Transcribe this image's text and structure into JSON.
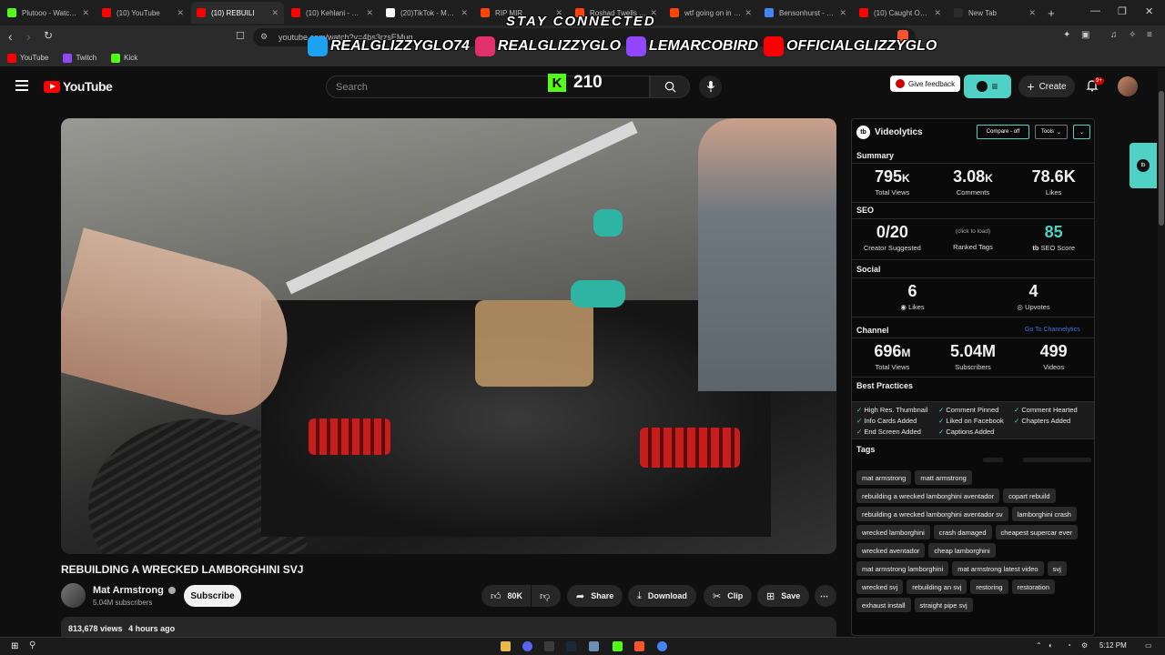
{
  "browser": {
    "tabs": [
      {
        "label": "Plutooo - Watch the",
        "color": "#53fc18",
        "active": false
      },
      {
        "label": "(10) YouTube",
        "color": "#ff0000",
        "active": false
      },
      {
        "label": "(10) REBUILI",
        "color": "#ff0000",
        "active": true
      },
      {
        "label": "(10) Kehlani - Foldi",
        "color": "#ff0000",
        "active": false
      },
      {
        "label": "(20)TikTok - Make",
        "color": "#ffffff",
        "active": false
      },
      {
        "label": "RIP MIR",
        "color": "#ff4500",
        "active": false
      },
      {
        "label": "Roshad Twells aka",
        "color": "#ff4500",
        "active": false
      },
      {
        "label": "wtf going on in Be",
        "color": "#ff4500",
        "active": false
      },
      {
        "label": "Bensonhurst - Goo",
        "color": "#4285f4",
        "active": false
      },
      {
        "label": "(10) Caught On Vi",
        "color": "#ff0000",
        "active": false
      },
      {
        "label": "New Tab",
        "color": "#2b2b2b",
        "active": false
      }
    ],
    "url": "youtube.com/watch?v=4bs3rzsEMug",
    "bookmarks": [
      {
        "label": "YouTube",
        "color": "#ff0000"
      },
      {
        "label": "Twitch",
        "color": "#9146ff"
      },
      {
        "label": "Kick",
        "color": "#53fc18"
      }
    ]
  },
  "overlay": {
    "title": "STAY CONNECTED",
    "socials": [
      {
        "handle": "REALGLIZZYGLO74",
        "icon": "twitter-icon",
        "color": "#1da1f2"
      },
      {
        "handle": "REALGLIZZYGLO",
        "icon": "instagram-icon",
        "color": "#e1306c"
      },
      {
        "handle": "LEMARCOBIRD",
        "icon": "twitch-icon",
        "color": "#9146ff"
      },
      {
        "handle": "OFFICIALGLIZZYGLO",
        "icon": "youtube-icon",
        "color": "#ff0000"
      }
    ],
    "kick_viewers": "210"
  },
  "youtube": {
    "logo": "YouTube",
    "search_placeholder": "Search",
    "feedback": "Give feedback",
    "create": "Create",
    "notifications": "9+"
  },
  "video": {
    "title": "REBUILDING A WRECKED LAMBORGHINI SVJ",
    "channel": "Mat Armstrong",
    "subscribers": "5.04M subscribers",
    "subscribe": "Subscribe",
    "likes": "80K",
    "share": "Share",
    "download": "Download",
    "clip": "Clip",
    "save": "Save",
    "views": "813,678 views",
    "age": "4 hours ago"
  },
  "videolytics": {
    "name": "Videolytics",
    "compare": "Compare - off",
    "tools": "Tools",
    "summary_label": "Summary",
    "summary": [
      {
        "n": "795",
        "suffix": "K",
        "label": "Total Views"
      },
      {
        "n": "3.08",
        "suffix": "K",
        "label": "Comments"
      },
      {
        "n": "78.6K",
        "suffix": "",
        "label": "Likes"
      }
    ],
    "seo_label": "SEO",
    "seo": {
      "creator_suggested": "0/20",
      "creator_label": "Creator Suggested",
      "ranked_hint": "(click to load)",
      "ranked_label": "Ranked Tags",
      "score": "85",
      "score_label": "SEO Score"
    },
    "social_label": "Social",
    "social": [
      {
        "n": "6",
        "label": "Likes"
      },
      {
        "n": "4",
        "label": "Upvotes"
      }
    ],
    "channel_label": "Channel",
    "channel_link": "Go To Channelytics",
    "channel": [
      {
        "n": "696",
        "suffix": "M",
        "label": "Total Views"
      },
      {
        "n": "5.04M",
        "suffix": "",
        "label": "Subscribers"
      },
      {
        "n": "499",
        "suffix": "",
        "label": "Videos"
      }
    ],
    "best_label": "Best Practices",
    "best": [
      "High Res. Thumbnail",
      "Comment Pinned",
      "Comment Hearted",
      "Info Cards Added",
      "Liked on Facebook",
      "Chapters Added",
      "End Screen Added",
      "Captions Added"
    ],
    "tags_label": "Tags",
    "tags": [
      "mat armstrong",
      "matt armstrong",
      "rebuilding a wrecked lamborghini aventador",
      "copart rebuild",
      "rebuilding a wrecked lamborghini aventador sv",
      "lamborghini crash",
      "wrecked lamborghini",
      "crash damaged",
      "cheapest supercar ever",
      "wrecked aventador",
      "cheap lamborghini",
      "mat armstrong lamborghini",
      "mat armstrong latest video",
      "svj",
      "wrecked svj",
      "rebuilding an svj",
      "restoring",
      "restoration",
      "exhaust install",
      "straight pipe svj"
    ]
  },
  "taskbar": {
    "time": "5:12 PM"
  }
}
